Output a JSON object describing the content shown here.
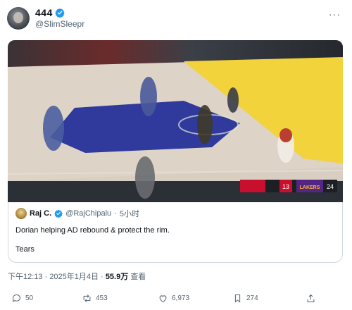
{
  "author": {
    "display_name": "444",
    "handle": "@SlimSleepr"
  },
  "media": {
    "scoreboard": {
      "home_score": "13",
      "away_team": "LAKERS",
      "away_score": "24"
    }
  },
  "quoted_post": {
    "display_name": "Raj C.",
    "handle": "@RajChipalu",
    "separator": "·",
    "time": "5小时",
    "line1": "Dorian helping AD rebound & protect the rim.",
    "line2": "Tears"
  },
  "meta": {
    "time": "下午12:13",
    "separator1": " · ",
    "date": "2025年1月4日",
    "separator2": " · ",
    "views": "55.9万",
    "views_label": " 查看"
  },
  "actions": {
    "replies": "50",
    "reposts": "453",
    "likes": "6,973",
    "bookmarks": "274"
  },
  "colors": {
    "verified": "#1d9bf0",
    "court_blue": "#2f3a9c",
    "court_yellow": "#f2d33b"
  }
}
